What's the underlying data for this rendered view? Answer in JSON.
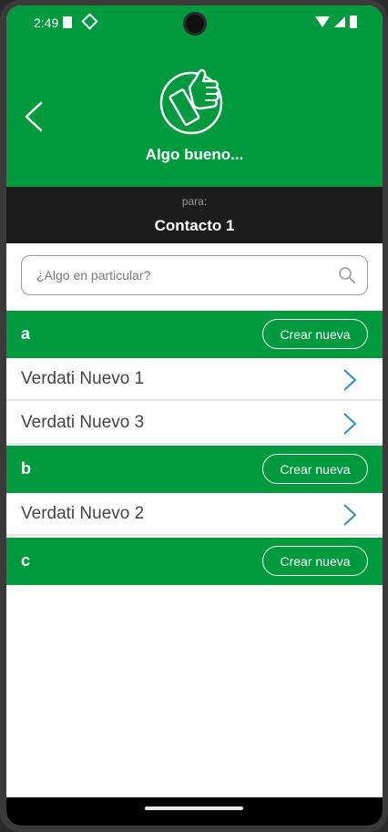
{
  "status_bar": {
    "time": "2:49",
    "icons": [
      "sim-card-icon",
      "diamond-icon",
      "wifi-icon",
      "signal-icon",
      "battery-icon"
    ]
  },
  "header": {
    "title": "Algo bueno...",
    "icon": "thumbs-up-icon",
    "back_icon": "back-chevron-icon"
  },
  "recipient": {
    "label": "para:",
    "contact": "Contacto 1"
  },
  "search": {
    "placeholder": "¿Algo en particular?",
    "value": ""
  },
  "sections": [
    {
      "letter": "a",
      "create_label": "Crear nueva",
      "items": [
        "Verdati Nuevo 1",
        "Verdati Nuevo 3"
      ]
    },
    {
      "letter": "b",
      "create_label": "Crear nueva",
      "items": [
        "Verdati Nuevo 2"
      ]
    },
    {
      "letter": "c",
      "create_label": "Crear nueva",
      "items": []
    }
  ],
  "colors": {
    "brand_green": "#009a3e",
    "dark_bar": "#1c1c1c",
    "chevron_blue": "#2a8fc7"
  }
}
